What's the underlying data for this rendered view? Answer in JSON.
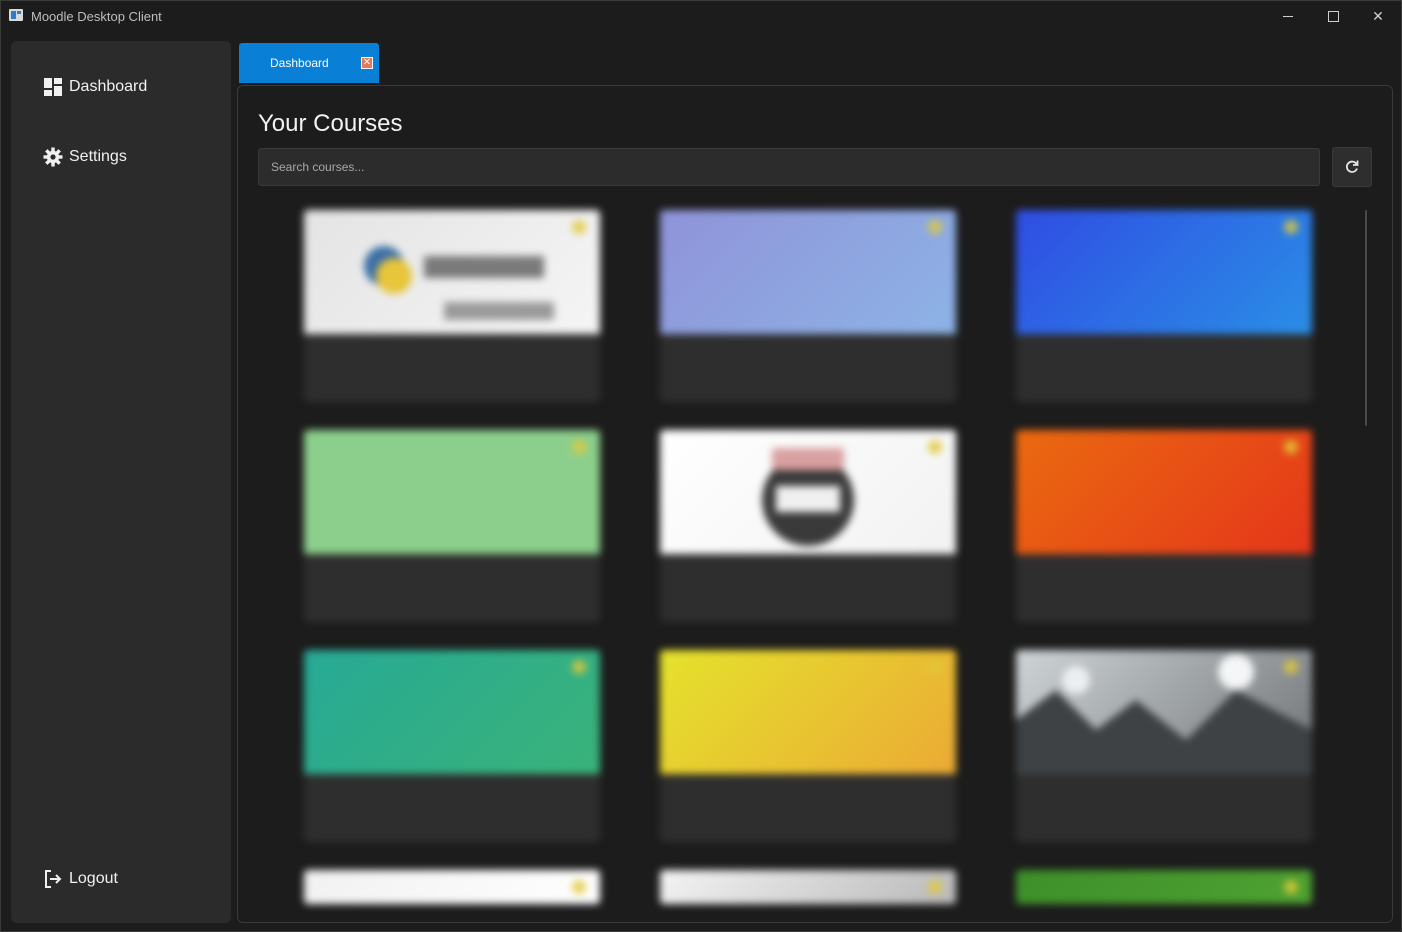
{
  "window": {
    "title": "Moodle Desktop Client"
  },
  "sidebar": {
    "items": [
      {
        "label": "Dashboard",
        "icon": "dashboard-icon"
      },
      {
        "label": "Settings",
        "icon": "gear-icon"
      }
    ],
    "logout": {
      "label": "Logout",
      "icon": "logout-icon"
    }
  },
  "tabs": [
    {
      "label": "Dashboard",
      "close_icon": "close-icon",
      "active_color": "#0a7fd6"
    }
  ],
  "main": {
    "title": "Your Courses",
    "search": {
      "placeholder": "Search courses...",
      "value": ""
    },
    "refresh_icon": "refresh-icon"
  },
  "courses": [
    {
      "title": "",
      "subtitle": "",
      "meta": "",
      "image_colors": [
        "#e4e4e4",
        "#f5f5f5"
      ],
      "image_icon": "python-logo"
    },
    {
      "title": "",
      "subtitle": "",
      "meta": "",
      "image_colors": [
        "#8f93d9",
        "#8db3e6"
      ]
    },
    {
      "title": "",
      "subtitle": "",
      "meta": "",
      "image_colors": [
        "#2f4de3",
        "#2a8ee6"
      ]
    },
    {
      "title": "",
      "subtitle": "",
      "meta": "",
      "image_colors": [
        "#8ccf8c",
        "#8ccf8c"
      ]
    },
    {
      "title": "",
      "subtitle": "",
      "meta": "",
      "image_colors": [
        "#ffffff",
        "#f2f2f2"
      ],
      "image_icon": "badge-logo"
    },
    {
      "title": "",
      "subtitle": "",
      "meta": "",
      "image_colors": [
        "#ea6a10",
        "#e5361a"
      ]
    },
    {
      "title": "",
      "subtitle": "",
      "meta": "",
      "image_colors": [
        "#27a995",
        "#3ab37a"
      ]
    },
    {
      "title": "",
      "subtitle": "",
      "meta": "",
      "image_colors": [
        "#e5e22c",
        "#ebaa35"
      ]
    },
    {
      "title": "",
      "subtitle": "",
      "meta": "",
      "image_colors": [
        "#cfd4d6",
        "#6f7376"
      ],
      "image_icon": "photo"
    },
    {
      "title": "",
      "subtitle": "",
      "meta": "",
      "image_colors": [
        "#f1f1f1",
        "#ffffff"
      ]
    },
    {
      "title": "",
      "subtitle": "",
      "meta": "",
      "image_colors": [
        "#f3f3f3",
        "#b9b9b9"
      ]
    },
    {
      "title": "",
      "subtitle": "",
      "meta": "",
      "image_colors": [
        "#3d8f2a",
        "#4fa232"
      ]
    }
  ]
}
